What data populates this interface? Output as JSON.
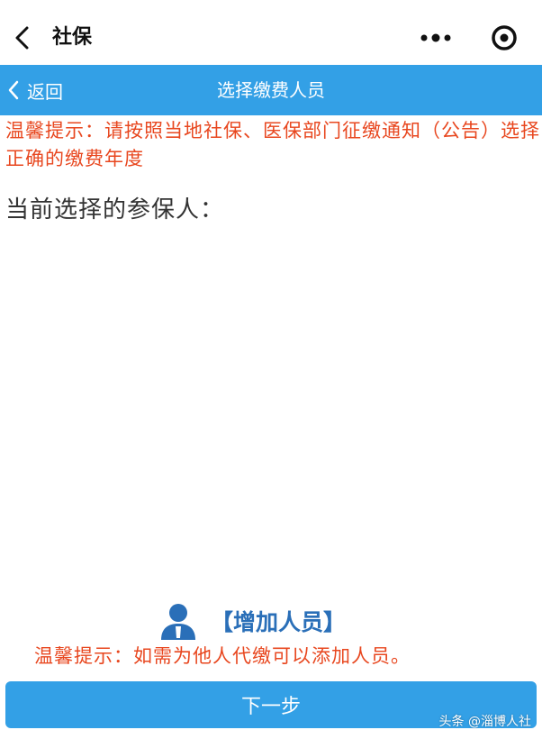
{
  "topbar": {
    "title": "社保",
    "back_icon": "chevron-left-icon",
    "more_icon": "more-dots-icon",
    "eye_icon": "target-icon"
  },
  "header": {
    "back_label": "返回",
    "title": "选择缴费人员",
    "color": "#33a0e6"
  },
  "notice_top": "温馨提示：请按照当地社保、医保部门征缴通知（公告）选择正确的缴费年度",
  "selected_label": "当前选择的参保人：",
  "add_person": {
    "label": "【增加人员】",
    "icon": "person-icon",
    "color": "#2a6fb8"
  },
  "notice_bottom": "温馨提示：如需为他人代缴可以添加人员。",
  "next_button": "下一步",
  "watermark": "头条 @淄博人社",
  "colors": {
    "notice": "#e8471f",
    "primary": "#33a0e6"
  }
}
